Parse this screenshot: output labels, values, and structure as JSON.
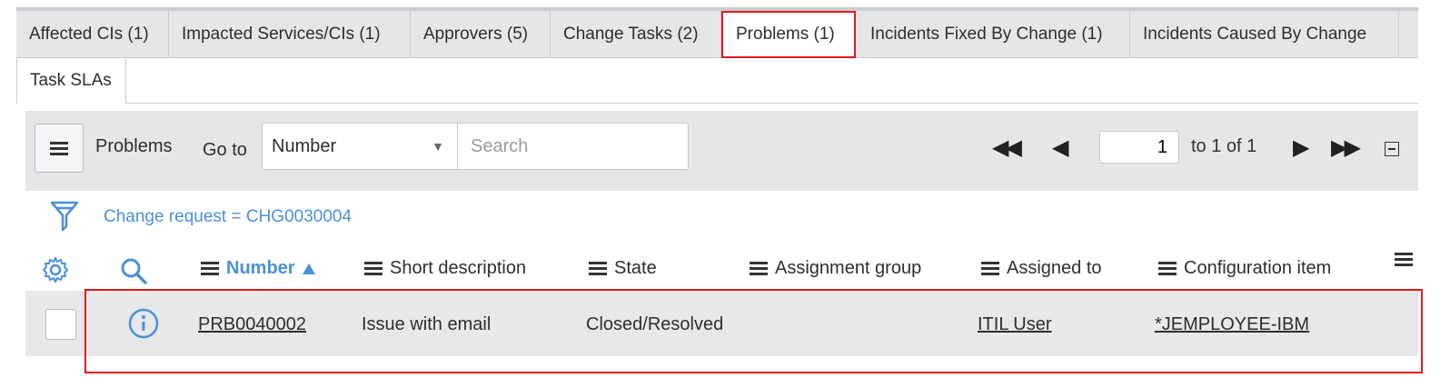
{
  "tabs": {
    "row1": [
      "Affected CIs (1)",
      "Impacted Services/CIs (1)",
      "Approvers (5)",
      "Change Tasks (2)",
      "Problems (1)",
      "Incidents Fixed By Change (1)",
      "Incidents Caused By Change"
    ],
    "row2": [
      "Task SLAs"
    ],
    "active": "Problems (1)"
  },
  "list": {
    "title": "Problems",
    "goto_label": "Go to",
    "field_select": "Number",
    "search_placeholder": "Search",
    "page_input": "1",
    "page_text": "to 1 of 1",
    "filter": "Change request = CHG0030004"
  },
  "columns": [
    "Number",
    "Short description",
    "State",
    "Assignment group",
    "Assigned to",
    "Configuration item"
  ],
  "sorted_column": "Number",
  "rows": [
    {
      "number": "PRB0040002",
      "short_description": "Issue with email",
      "state": "Closed/Resolved",
      "assignment_group": "",
      "assigned_to": "ITIL User",
      "configuration_item": "*JEMPLOYEE-IBM"
    }
  ],
  "colors": {
    "accent": "#4a90d9",
    "highlight": "#e0191f",
    "tab_bg": "#e4e6e8"
  },
  "icons": [
    "list-menu-icon",
    "first-page-icon",
    "previous-page-icon",
    "next-page-icon",
    "last-page-icon",
    "collapse-icon",
    "filter-icon",
    "gear-icon",
    "search-icon",
    "info-icon"
  ]
}
